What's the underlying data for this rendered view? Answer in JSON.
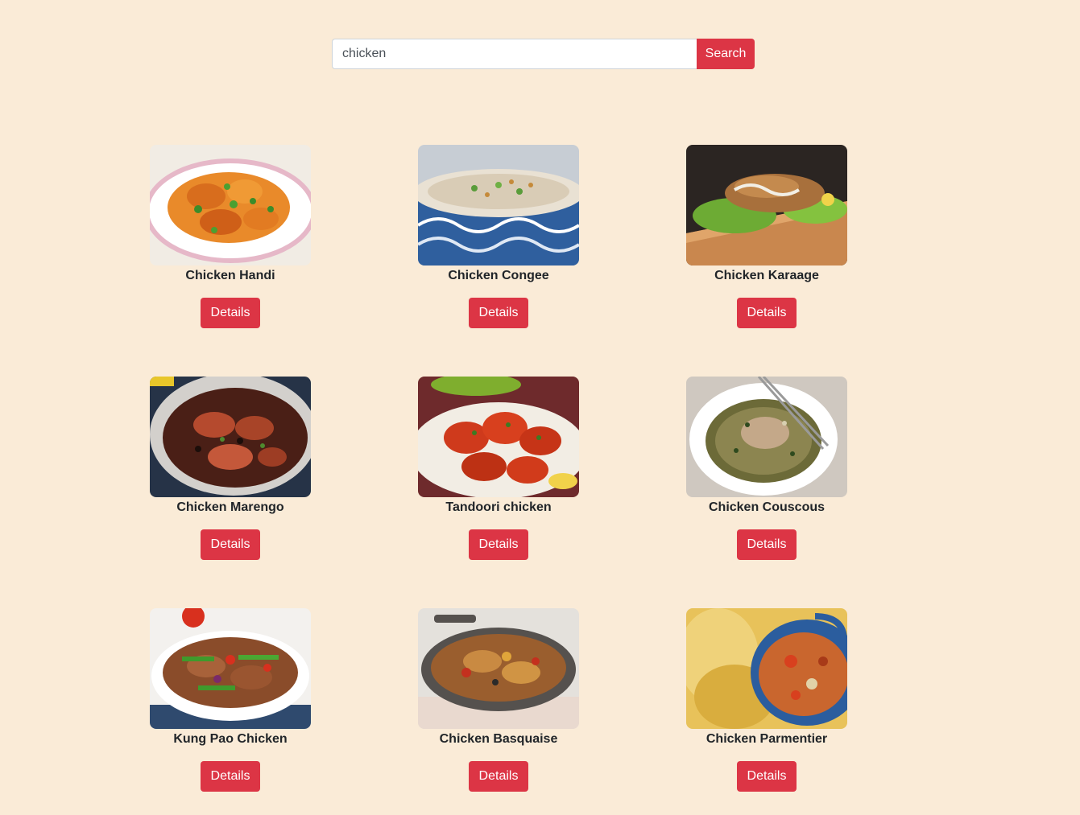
{
  "search": {
    "value": "chicken",
    "button_label": "Search"
  },
  "theme": {
    "page_background": "#faebd7",
    "accent": "#dc3545",
    "button_text": "#ffffff"
  },
  "meals": [
    {
      "name": "Chicken Handi",
      "details_label": "Details",
      "image": "chicken-handi-photo"
    },
    {
      "name": "Chicken Congee",
      "details_label": "Details",
      "image": "chicken-congee-photo"
    },
    {
      "name": "Chicken Karaage",
      "details_label": "Details",
      "image": "chicken-karaage-photo"
    },
    {
      "name": "Chicken Marengo",
      "details_label": "Details",
      "image": "chicken-marengo-photo"
    },
    {
      "name": "Tandoori chicken",
      "details_label": "Details",
      "image": "tandoori-chicken-photo"
    },
    {
      "name": "Chicken Couscous",
      "details_label": "Details",
      "image": "chicken-couscous-photo"
    },
    {
      "name": "Kung Pao Chicken",
      "details_label": "Details",
      "image": "kung-pao-chicken-photo"
    },
    {
      "name": "Chicken Basquaise",
      "details_label": "Details",
      "image": "chicken-basquaise-photo"
    },
    {
      "name": "Chicken Parmentier",
      "details_label": "Details",
      "image": "chicken-parmentier-photo"
    }
  ]
}
